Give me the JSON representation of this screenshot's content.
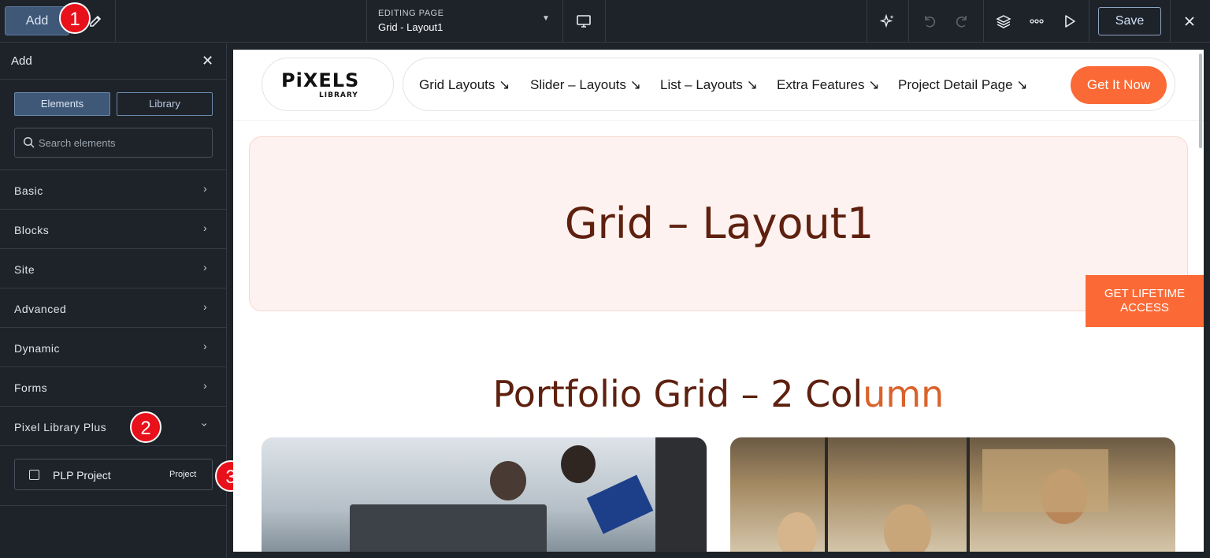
{
  "topbar": {
    "add_label": "Add",
    "editing_label": "EDITING PAGE",
    "page_name": "Grid - Layout1",
    "save_label": "Save"
  },
  "badges": {
    "one": "1",
    "two": "2",
    "three": "3"
  },
  "sidebar": {
    "title": "Add",
    "tabs": [
      {
        "label": "Elements"
      },
      {
        "label": "Library"
      }
    ],
    "search_placeholder": "Search elements",
    "categories": [
      {
        "label": "Basic"
      },
      {
        "label": "Blocks"
      },
      {
        "label": "Site"
      },
      {
        "label": "Advanced"
      },
      {
        "label": "Dynamic"
      },
      {
        "label": "Forms"
      },
      {
        "label": "Pixel Library Plus"
      }
    ],
    "element": {
      "name": "PLP Project",
      "tag": "Project"
    }
  },
  "site": {
    "logo_text": "PiXELS",
    "logo_sub": "LIBRARY",
    "nav": [
      {
        "label": "Grid Layouts ↘"
      },
      {
        "label": "Slider – Layouts ↘"
      },
      {
        "label": "List – Layouts ↘"
      },
      {
        "label": "Extra Features ↘"
      },
      {
        "label": "Project Detail Page ↘"
      }
    ],
    "cta_label": "Get It Now",
    "hero_title": "Grid – Layout1",
    "section_title_main": "Portfolio Grid – 2 Col",
    "section_title_accent": "umn",
    "lifetime_line1": "GET LIFETIME",
    "lifetime_line2": "ACCESS"
  },
  "colors": {
    "brand": "#fb6a36",
    "heading": "#5e200f",
    "ui_bg": "#1e2329",
    "ui_accent": "#3f5878",
    "badge": "#e8101a"
  }
}
